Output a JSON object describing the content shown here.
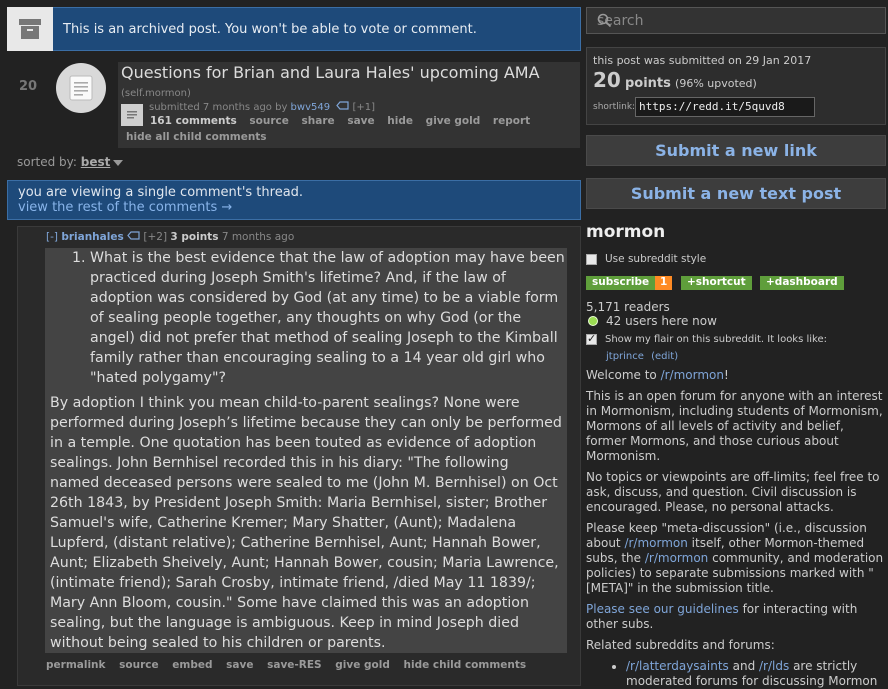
{
  "archived_banner": {
    "message": "This is an archived post. You won't be able to vote or comment.",
    "icon": "archive-box-icon"
  },
  "post": {
    "score": "20",
    "thumbnail_icon": "text-post-icon",
    "title": "Questions for Brian and Laura Hales' upcoming AMA",
    "domain": "(self.mormon)",
    "submitted_prefix": "submitted 7 months ago by",
    "author": "bwv549",
    "author_badge": "[+1]",
    "buttons": [
      "161 comments",
      "source",
      "share",
      "save",
      "hide",
      "give gold",
      "report"
    ],
    "hide_all": "hide all child comments"
  },
  "sort": {
    "label": "sorted by:",
    "value": "best"
  },
  "thread_notice": {
    "line1": "you are viewing a single comment's thread.",
    "link": "view the rest of the comments →"
  },
  "comment": {
    "expand": "[-]",
    "author": "brianhales",
    "badge": "[+2]",
    "points": "3 points",
    "time": "7 months ago",
    "list_item": "What is the best evidence that the law of adoption may have been practiced during Joseph Smith's lifetime? And, if the law of adoption was considered by God (at any time) to be a viable form of sealing people together, any thoughts on why God (or the angel) did not prefer that method of sealing Joseph to the Kimball family rather than encouraging sealing to a 14 year old girl who \"hated polygamy\"?",
    "paragraph": "By adoption I think you mean child-to-parent sealings? None were performed during Joseph’s lifetime because they can only be performed in a temple. One quotation has been touted as evidence of adoption sealings. John Bernhisel recorded this in his diary: \"The following named deceased persons were sealed to me (John M. Bernhisel) on Oct 26th 1843, by President Joseph Smith: Maria Bernhisel, sister; Brother Samuel's wife, Catherine Kremer; Mary Shatter, (Aunt); Madalena Lupferd, (distant relative); Catherine Bernhisel, Aunt; Hannah Bower, Aunt; Elizabeth Sheively, Aunt; Hannah Bower, cousin; Maria Lawrence, (intimate friend); Sarah Crosby, intimate friend, /died May 11 1839/; Mary Ann Bloom, cousin.\" Some have claimed this was an adoption sealing, but the language is ambiguous. Keep in mind Joseph died without being sealed to his children or parents.",
    "buttons": [
      "permalink",
      "source",
      "embed",
      "save",
      "save-RES",
      "give gold",
      "hide child comments"
    ]
  },
  "sidebar": {
    "search_placeholder": "search",
    "submitted_date": "this post was submitted on 29 Jan 2017",
    "points": "20",
    "points_word": "points",
    "upvoted": "(96% upvoted)",
    "shortlink_label": "shortlink:",
    "shortlink": "https://redd.it/5quvd8",
    "submit_link": "Submit a new link",
    "submit_text": "Submit a new text post",
    "subreddit": "mormon",
    "use_style": "Use subreddit style",
    "subscribe": "subscribe",
    "subscribe_count": "1",
    "shortcut": "+shortcut",
    "dashboard": "+dashboard",
    "readers": "5,171 readers",
    "online": "42 users here now",
    "flair_text": "Show my flair on this subreddit. It looks like:",
    "flair_user": "jtprince",
    "flair_edit": "(edit)",
    "welcome_prefix": "Welcome to ",
    "welcome_link": "/r/mormon",
    "welcome_suffix": "!",
    "p1": "This is an open forum for anyone with an interest in Mormonism, including students of Mormonism, Mormons of all levels of activity and belief, former Mormons, and those curious about Mormonism.",
    "p2": "No topics or viewpoints are off-limits; feel free to ask, discuss, and question. Civil discussion is encouraged. Please, no personal attacks.",
    "p3_a": "Please keep \"meta-discussion\" (i.e., discussion about ",
    "p3_link1": "/r/mormon",
    "p3_b": " itself, other Mormon-themed subs, the ",
    "p3_link2": "/r/mormon",
    "p3_c": " community, and moderation policies) to separate submissions marked with \"[META]\" in the submission title.",
    "p4_link": "Please see our guidelines",
    "p4_rest": " for interacting with other subs.",
    "related": "Related subreddits and forums:",
    "rel_link1": "/r/latterdaysaints",
    "rel_and": " and ",
    "rel_link2": "/r/lds",
    "rel_rest": " are strictly moderated forums for discussing Mormon"
  }
}
